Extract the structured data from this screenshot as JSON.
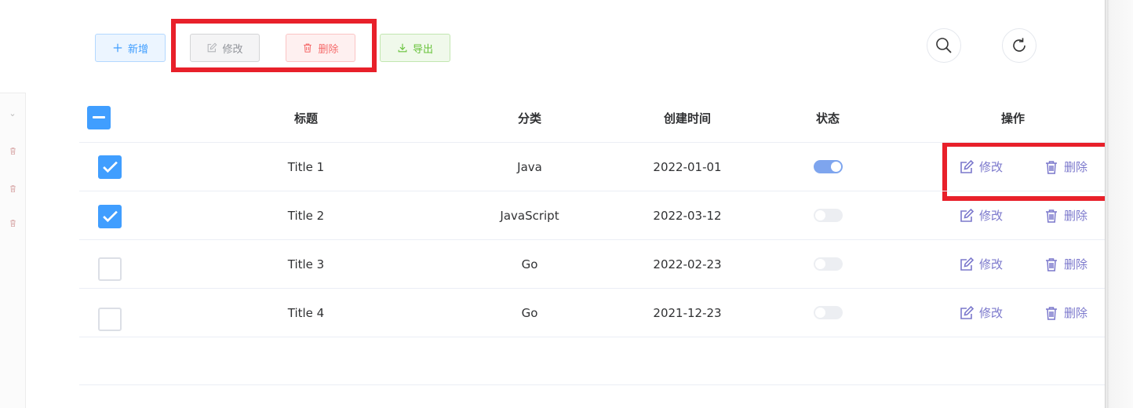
{
  "toolbar": {
    "add_label": "新增",
    "edit_label": "修改",
    "delete_label": "删除",
    "export_label": "导出"
  },
  "table": {
    "headers": {
      "title": "标题",
      "category": "分类",
      "created": "创建时间",
      "status": "状态",
      "actions": "操作"
    },
    "rows": [
      {
        "title": "Title 1",
        "category": "Java",
        "created": "2022-01-01",
        "checked": true,
        "status_on": true
      },
      {
        "title": "Title 2",
        "category": "JavaScript",
        "created": "2022-03-12",
        "checked": true,
        "status_on": false
      },
      {
        "title": "Title 3",
        "category": "Go",
        "created": "2022-02-23",
        "checked": false,
        "status_on": false
      },
      {
        "title": "Title 4",
        "category": "Go",
        "created": "2021-12-23",
        "checked": false,
        "status_on": false
      }
    ],
    "row_actions": {
      "edit": "修改",
      "delete": "删除"
    }
  },
  "colors": {
    "primary": "#409eff",
    "danger": "#f56c6c",
    "success": "#67c23a",
    "action_text": "#7b78cc",
    "highlight": "#e8202a"
  },
  "icons": {
    "add": "plus-icon",
    "edit": "edit-icon",
    "delete": "trash-icon",
    "export": "download-icon",
    "search": "search-icon",
    "refresh": "refresh-icon"
  }
}
